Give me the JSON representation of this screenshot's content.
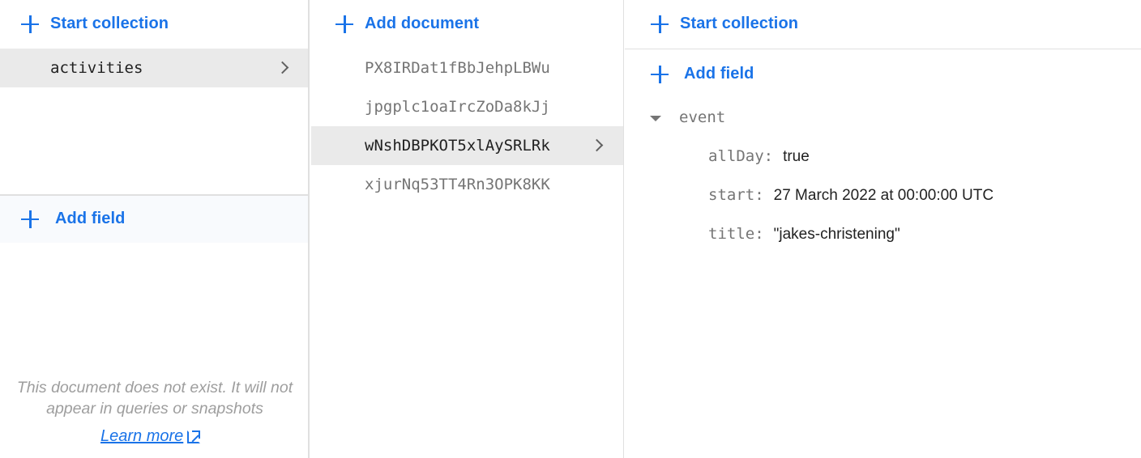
{
  "colors": {
    "accent": "#1a73e8",
    "selected_row": "#eaeaea",
    "muted_text": "#757575"
  },
  "root_panel": {
    "start_collection_label": "Start collection",
    "collections": [
      {
        "name": "activities",
        "selected": true
      }
    ],
    "add_field_label": "Add field",
    "notice": "This document does not exist. It will not appear in queries or snapshots",
    "learn_more_label": "Learn more"
  },
  "collection_panel": {
    "add_document_label": "Add document",
    "documents": [
      {
        "id": "PX8IRDat1fBbJehpLBWu",
        "selected": false
      },
      {
        "id": "jpgplc1oaIrcZoDa8kJj",
        "selected": false
      },
      {
        "id": "wNshDBPKOT5xlAySRLRk",
        "selected": true
      },
      {
        "id": "xjurNq53TT4Rn3OPK8KK",
        "selected": false
      }
    ]
  },
  "document_panel": {
    "start_collection_label": "Start collection",
    "add_field_label": "Add field",
    "map_field": {
      "name": "event",
      "expanded": true,
      "fields": [
        {
          "key": "allDay:",
          "value": "true"
        },
        {
          "key": "start:",
          "value": "27 March 2022 at 00:00:00 UTC"
        },
        {
          "key": "title:",
          "value": "\"jakes-christening\""
        }
      ]
    }
  }
}
